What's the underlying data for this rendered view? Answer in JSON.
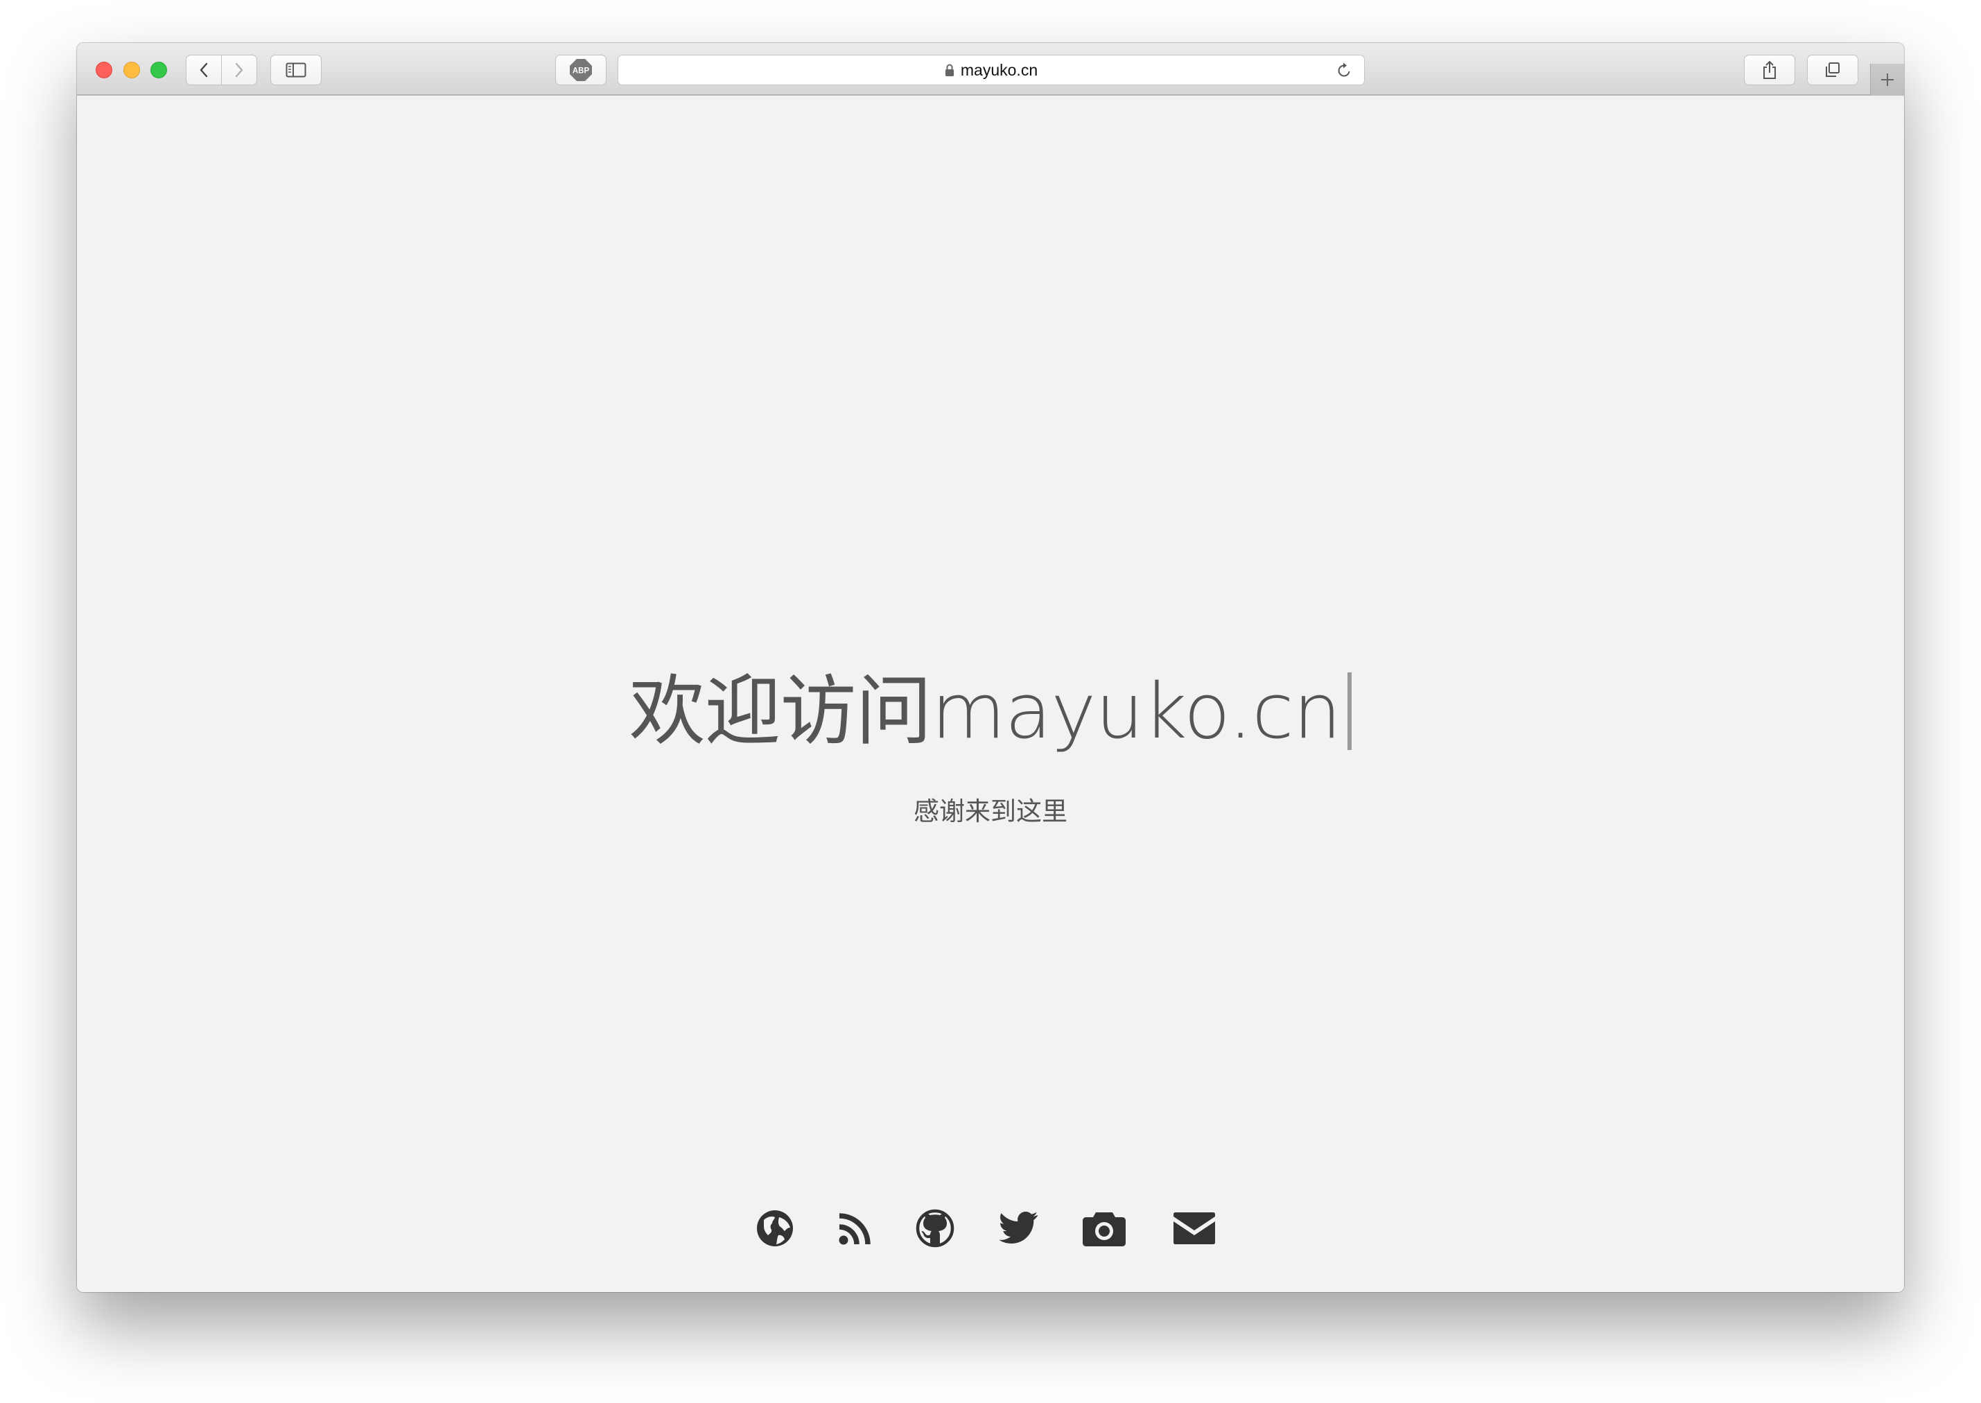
{
  "browser": {
    "address": {
      "url": "mayuko.cn",
      "secure": true
    },
    "toolbar": {
      "back": "chevron-left-icon",
      "forward": "chevron-right-icon",
      "sidebar": "sidebar-icon",
      "extension": "adblock-plus-icon",
      "extension_label": "ABP",
      "reload": "reload-icon",
      "share": "share-icon",
      "tabs": "tab-overview-icon",
      "new_tab": "plus-icon"
    },
    "traffic_lights": [
      "close",
      "minimize",
      "maximize"
    ]
  },
  "page": {
    "headline": "欢迎访问mayuko.cn",
    "subtitle": "感谢来到这里",
    "social_links": [
      {
        "name": "globe-icon"
      },
      {
        "name": "rss-icon"
      },
      {
        "name": "github-icon"
      },
      {
        "name": "twitter-icon"
      },
      {
        "name": "camera-icon"
      },
      {
        "name": "envelope-icon"
      }
    ],
    "colors": {
      "text": "#555555",
      "icons": "#333333",
      "background": "#f2f2f4"
    }
  }
}
